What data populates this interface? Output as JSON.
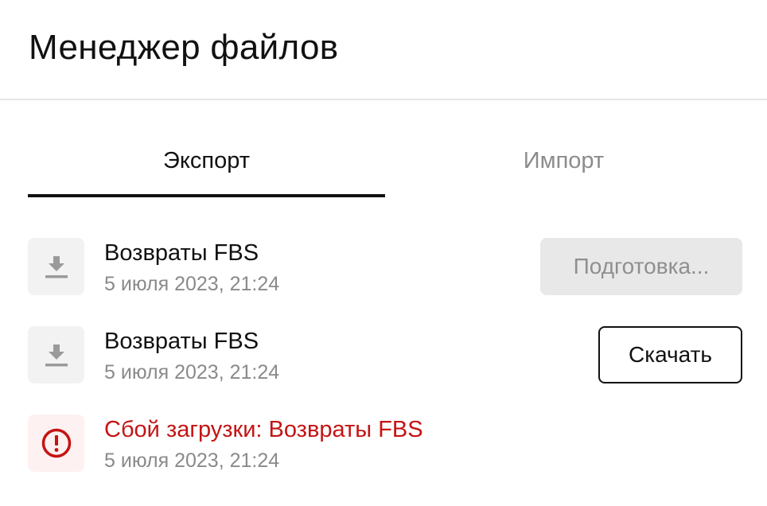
{
  "header": {
    "title": "Менеджер файлов"
  },
  "tabs": [
    {
      "label": "Экспорт",
      "active": true
    },
    {
      "label": "Импорт",
      "active": false
    }
  ],
  "files": [
    {
      "name": "Возвраты FBS",
      "date": "5 июля 2023, 21:24",
      "status": "preparing",
      "icon": "download-icon",
      "action_label": "Подготовка..."
    },
    {
      "name": "Возвраты FBS",
      "date": "5 июля 2023, 21:24",
      "status": "ready",
      "icon": "download-icon",
      "action_label": "Скачать"
    },
    {
      "name": "Сбой загрузки: Возвраты FBS",
      "date": "5 июля 2023, 21:24",
      "status": "error",
      "icon": "error-icon"
    }
  ],
  "colors": {
    "text": "#111111",
    "muted": "#8a8a8a",
    "error": "#c41414",
    "icon_bg": "#f2f2f2",
    "error_icon_bg": "#fdf1f1",
    "disabled_bg": "#e8e8e8"
  }
}
